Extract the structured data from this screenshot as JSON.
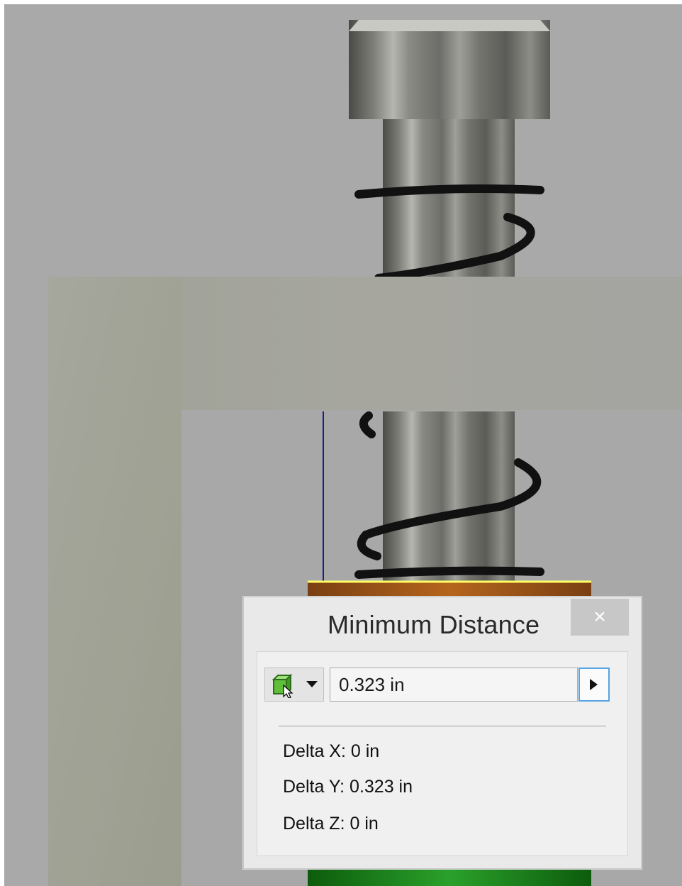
{
  "dialog": {
    "title": "Minimum Distance",
    "close_label": "×",
    "distance_value": "0.323 in",
    "delta_x": "Delta X: 0 in",
    "delta_y": "Delta Y: 0.323 in",
    "delta_z": "Delta Z: 0 in"
  },
  "icons": {
    "select_mode": "green-cube-select-icon",
    "dropdown": "chevron-down-icon",
    "expand": "triangle-right-icon",
    "close": "close-icon"
  },
  "colors": {
    "background": "#a9a9a9",
    "frame": "#a8a9a1",
    "spring": "#111111",
    "washer": "#8b4513",
    "highlight": "#ffff66",
    "base": "#1f7a1f",
    "accent": "#58a4e3"
  }
}
